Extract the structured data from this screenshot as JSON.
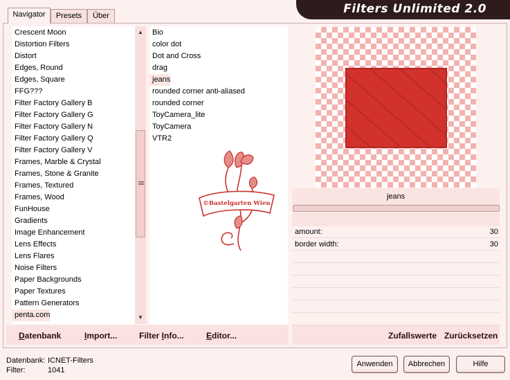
{
  "title": "Filters Unlimited 2.0",
  "tabs": [
    "Navigator",
    "Presets",
    "Über"
  ],
  "categories": [
    "Crescent Moon",
    "Distortion Filters",
    "Distort",
    "Edges, Round",
    "Edges, Square",
    "FFG???",
    "Filter Factory Gallery B",
    "Filter Factory Gallery G",
    "Filter Factory Gallery N",
    "Filter Factory Gallery Q",
    "Filter Factory Gallery V",
    "Frames, Marble & Crystal",
    "Frames, Stone & Granite",
    "Frames, Textured",
    "Frames, Wood",
    "FunHouse",
    "Gradients",
    "Image Enhancement",
    "Lens Effects",
    "Lens Flares",
    "Noise Filters",
    "Paper Backgrounds",
    "Paper Textures",
    "Pattern Generators",
    "penta.com"
  ],
  "selected_category": "penta.com",
  "filters": [
    "Bio",
    "color dot",
    "Dot and Cross",
    "drag",
    "jeans",
    "rounded corner anti-aliased",
    "rounded corner",
    "ToyCamera_lite",
    "ToyCamera",
    "VTR2"
  ],
  "selected_filter": "jeans",
  "watermark": "©Bastelgarten Wien",
  "preview_label": "jeans",
  "params": [
    {
      "label": "amount:",
      "value": "30"
    },
    {
      "label": "border width:",
      "value": "30"
    }
  ],
  "left_buttons": [
    {
      "pre": "",
      "u": "D",
      "post": "atenbank"
    },
    {
      "pre": "",
      "u": "I",
      "post": "mport..."
    },
    {
      "pre": "Filter ",
      "u": "I",
      "post": "nfo..."
    },
    {
      "pre": "",
      "u": "E",
      "post": "ditor..."
    }
  ],
  "right_buttons": [
    "Zufallswerte",
    "Zurücksetzen"
  ],
  "status": {
    "datenbank_label": "Datenbank:",
    "datenbank_value": "ICNET-Filters",
    "filter_label": "Filter:",
    "filter_value": "1041"
  },
  "dialog_buttons": {
    "apply": "Anwenden",
    "cancel": "Abbrechen",
    "help": "Hilfe"
  },
  "colors": {
    "accent": "#d1322c",
    "background": "#fdf1f0",
    "title_bar": "#2e1b1b"
  }
}
